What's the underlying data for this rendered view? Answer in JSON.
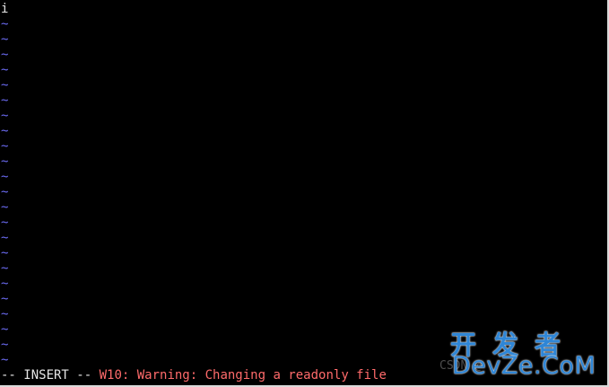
{
  "editor": {
    "first_line_text": "i",
    "empty_line_marker": "~",
    "empty_line_count": 23
  },
  "status": {
    "mode": "-- INSERT --",
    "warning": "W10: Warning: Changing a readonly file"
  },
  "watermark": {
    "ghost_text": "CSDN @",
    "cn": "开发者",
    "en": "DevZe.CoM"
  },
  "colors": {
    "background": "#000000",
    "text": "#e6e6e6",
    "tilde": "#6a6af0",
    "warning": "#ff6b6b",
    "watermark": "#2f86d6"
  }
}
